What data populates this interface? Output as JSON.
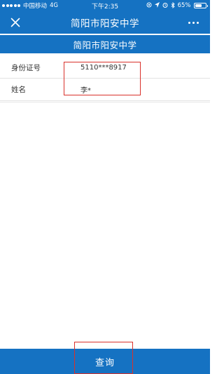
{
  "status_bar": {
    "carrier": "中国移动",
    "network": "4G",
    "time": "下午2:35",
    "battery_percent": "65%",
    "battery_level": 0.65
  },
  "nav_bar": {
    "title": "简阳市阳安中学",
    "close_icon": "close-icon",
    "more_icon": "more-icon"
  },
  "page": {
    "banner_title": "简阳市阳安中学"
  },
  "form": {
    "id_label": "身份证号",
    "id_value": "5110***8917",
    "name_label": "姓名",
    "name_value": "李*"
  },
  "footer": {
    "query_label": "查询"
  },
  "colors": {
    "primary": "#1572c2",
    "highlight": "#d9312b"
  }
}
